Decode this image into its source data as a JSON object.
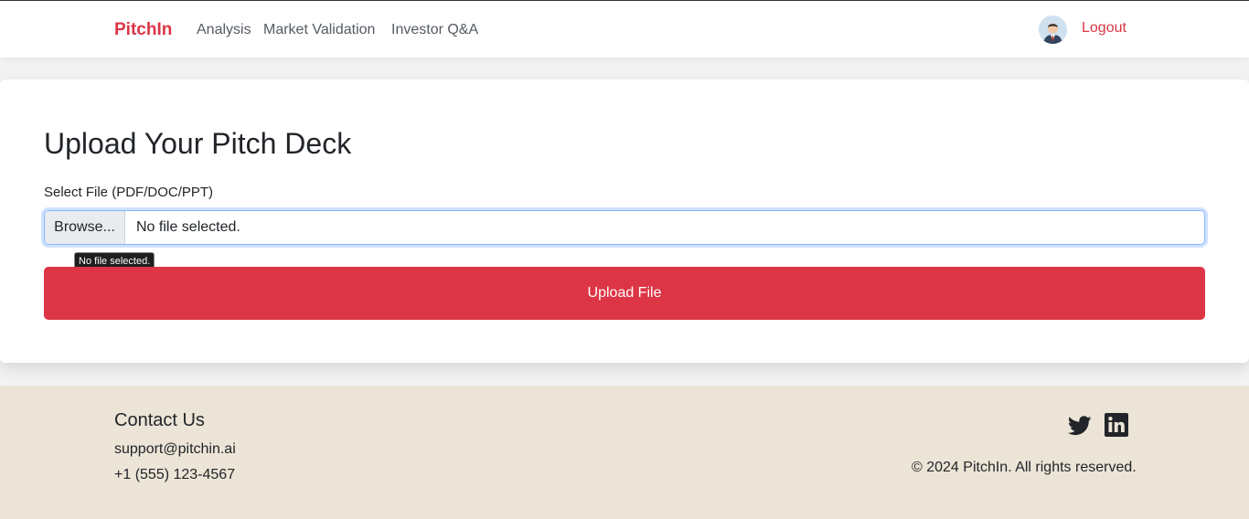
{
  "navbar": {
    "brand": "PitchIn",
    "links": [
      "Analysis",
      "Market Validation",
      "Investor Q&A"
    ],
    "avatar_icon": "user-avatar-icon",
    "logout_label": "Logout",
    "accent_color": "#dc3545"
  },
  "upload_card": {
    "title": "Upload Your Pitch Deck",
    "file_label": "Select File (PDF/DOC/PPT)",
    "browse_label": "Browse...",
    "file_status": "No file selected.",
    "tooltip": "No file selected.",
    "upload_button": "Upload File"
  },
  "footer": {
    "contact_title": "Contact Us",
    "email": "support@pitchin.ai",
    "phone": "+1 (555) 123-4567",
    "social_icons": [
      "twitter-icon",
      "linkedin-icon"
    ],
    "copyright": "© 2024 PitchIn. All rights reserved.",
    "background_color": "#ece4d6"
  }
}
